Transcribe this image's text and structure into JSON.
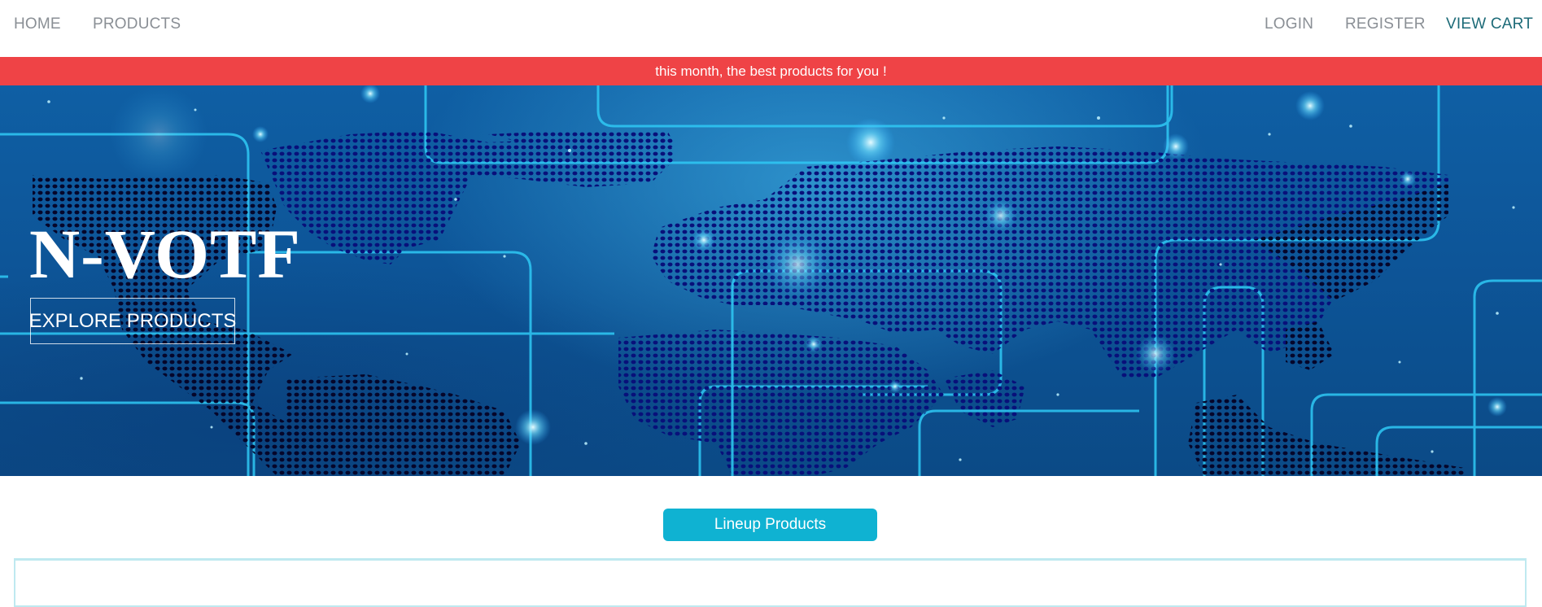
{
  "colors": {
    "accent_teal": "#1d6b78",
    "nav_text": "#8a8f95",
    "announce_bg": "#ef4346",
    "button_cyan": "#0fb2d2",
    "hero_blue": "#0d5598"
  },
  "nav": {
    "home": "HOME",
    "products": "PRODUCTS",
    "login": "LOGIN",
    "register": "REGISTER",
    "view_cart": "VIEW CART"
  },
  "announcement": "this month, the best products for you !",
  "hero": {
    "title": "N-VOTF",
    "cta": "EXPLORE PRODUCTS",
    "background": "digital-world-map"
  },
  "lineup": {
    "button_label": "Lineup Products"
  }
}
